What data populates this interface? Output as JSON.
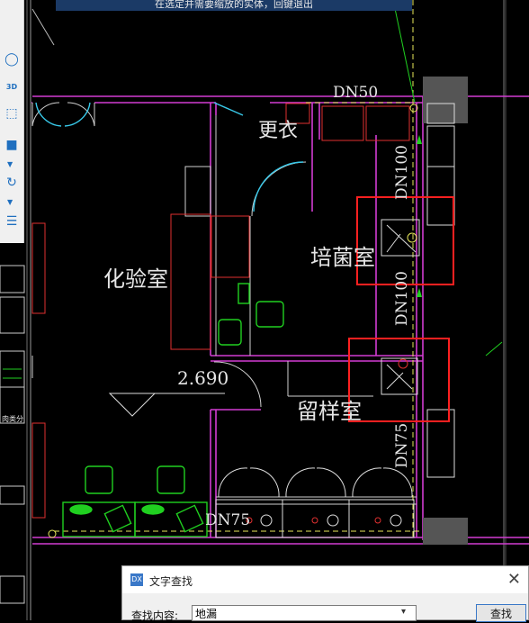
{
  "top_tip": "在选定并需要缩放的实体，回键退出",
  "toolbar": {
    "icons": [
      "sphere-icon",
      "box-3d-icon",
      "cube-icon",
      "solid-cube-icon",
      "rotate-icon",
      "properties-icon"
    ],
    "label_3d": "3D"
  },
  "drawing": {
    "rooms": {
      "changing": "更衣",
      "lab": "化验室",
      "culture": "培菌室",
      "sample": "留样室"
    },
    "pipes": {
      "dn50": "DN50",
      "dn100_top": "DN100",
      "dn100_bottom": "DN100",
      "dn75_vertical": "DN75",
      "dn75_horizontal": "DN75"
    },
    "elevation": "2.690",
    "side_label": "肉类分"
  },
  "find_dialog": {
    "title": "文字查找",
    "icon_text": "DX",
    "content_label": "查找内容:",
    "content_value": "地漏",
    "find_button": "查找",
    "close_symbol": "✕",
    "dropdown_symbol": "▾"
  }
}
